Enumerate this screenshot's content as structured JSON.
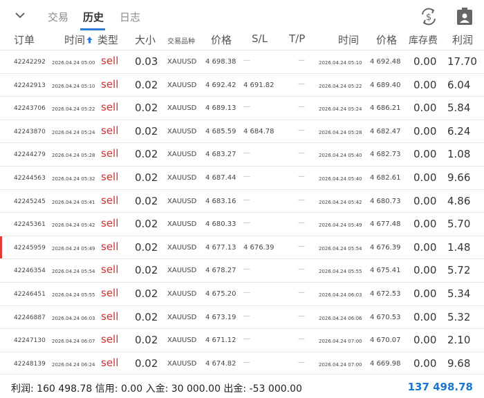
{
  "tabs": [
    {
      "label": "交易"
    },
    {
      "label": "历史"
    },
    {
      "label": "日志"
    }
  ],
  "icons": {
    "collapse": "chevron-down-icon",
    "currency": "dollar-refresh-icon",
    "report": "clipboard-person-icon"
  },
  "columns": {
    "order": "订单",
    "time": "时间",
    "type": "类型",
    "volume": "大小",
    "symbol": "交易品种",
    "price": "价格",
    "sl": "S/L",
    "tp": "T/P",
    "close_time": "时间",
    "close_price": "价格",
    "swap": "库存费",
    "profit": "利润"
  },
  "rows": [
    {
      "order": "42242292",
      "time": "2026.04.24 05:00",
      "type": "sell",
      "volume": "0.03",
      "symbol": "XAUUSD",
      "price": "4 698.38",
      "sl": "—",
      "tp": "—",
      "close_time": "2026.04.24 05:10",
      "close_price": "4 692.48",
      "swap": "0.00",
      "profit": "17.70"
    },
    {
      "order": "42242913",
      "time": "2026.04.24 05:10",
      "type": "sell",
      "volume": "0.02",
      "symbol": "XAUUSD",
      "price": "4 692.42",
      "sl": "4 691.82",
      "tp": "—",
      "close_time": "2026.04.24 05:22",
      "close_price": "4 689.40",
      "swap": "0.00",
      "profit": "6.04"
    },
    {
      "order": "42243706",
      "time": "2026.04.24 05:22",
      "type": "sell",
      "volume": "0.02",
      "symbol": "XAUUSD",
      "price": "4 689.13",
      "sl": "—",
      "tp": "—",
      "close_time": "2026.04.24 05:24",
      "close_price": "4 686.21",
      "swap": "0.00",
      "profit": "5.84"
    },
    {
      "order": "42243870",
      "time": "2026.04.24 05:24",
      "type": "sell",
      "volume": "0.02",
      "symbol": "XAUUSD",
      "price": "4 685.59",
      "sl": "4 684.78",
      "tp": "—",
      "close_time": "2026.04.24 05:28",
      "close_price": "4 682.47",
      "swap": "0.00",
      "profit": "6.24"
    },
    {
      "order": "42244279",
      "time": "2026.04.24 05:28",
      "type": "sell",
      "volume": "0.02",
      "symbol": "XAUUSD",
      "price": "4 683.27",
      "sl": "—",
      "tp": "—",
      "close_time": "2026.04.24 05:40",
      "close_price": "4 682.73",
      "swap": "0.00",
      "profit": "1.08"
    },
    {
      "order": "42244563",
      "time": "2026.04.24 05:32",
      "type": "sell",
      "volume": "0.02",
      "symbol": "XAUUSD",
      "price": "4 687.44",
      "sl": "—",
      "tp": "—",
      "close_time": "2026.04.24 05:40",
      "close_price": "4 682.61",
      "swap": "0.00",
      "profit": "9.66"
    },
    {
      "order": "42245245",
      "time": "2026.04.24 05:41",
      "type": "sell",
      "volume": "0.02",
      "symbol": "XAUUSD",
      "price": "4 683.16",
      "sl": "—",
      "tp": "—",
      "close_time": "2026.04.24 05:42",
      "close_price": "4 680.73",
      "swap": "0.00",
      "profit": "4.86"
    },
    {
      "order": "42245361",
      "time": "2026.04.24 05:42",
      "type": "sell",
      "volume": "0.02",
      "symbol": "XAUUSD",
      "price": "4 680.33",
      "sl": "—",
      "tp": "—",
      "close_time": "2026.04.24 05:49",
      "close_price": "4 677.48",
      "swap": "0.00",
      "profit": "5.70"
    },
    {
      "order": "42245959",
      "time": "2026.04.24 05:49",
      "type": "sell",
      "volume": "0.02",
      "symbol": "XAUUSD",
      "price": "4 677.13",
      "sl": "4 676.39",
      "tp": "—",
      "close_time": "2026.04.24 05:54",
      "close_price": "4 676.39",
      "swap": "0.00",
      "profit": "1.48",
      "marked": true
    },
    {
      "order": "42246354",
      "time": "2026.04.24 05:54",
      "type": "sell",
      "volume": "0.02",
      "symbol": "XAUUSD",
      "price": "4 678.27",
      "sl": "—",
      "tp": "—",
      "close_time": "2026.04.24 05:55",
      "close_price": "4 675.41",
      "swap": "0.00",
      "profit": "5.72"
    },
    {
      "order": "42246451",
      "time": "2026.04.24 05:55",
      "type": "sell",
      "volume": "0.02",
      "symbol": "XAUUSD",
      "price": "4 675.20",
      "sl": "—",
      "tp": "—",
      "close_time": "2026.04.24 06:03",
      "close_price": "4 672.53",
      "swap": "0.00",
      "profit": "5.34"
    },
    {
      "order": "42246887",
      "time": "2026.04.24 06:03",
      "type": "sell",
      "volume": "0.02",
      "symbol": "XAUUSD",
      "price": "4 673.19",
      "sl": "—",
      "tp": "—",
      "close_time": "2026.04.24 06:06",
      "close_price": "4 670.53",
      "swap": "0.00",
      "profit": "5.32"
    },
    {
      "order": "42247130",
      "time": "2026.04.24 06:07",
      "type": "sell",
      "volume": "0.02",
      "symbol": "XAUUSD",
      "price": "4 671.12",
      "sl": "—",
      "tp": "—",
      "close_time": "2026.04.24 07:00",
      "close_price": "4 670.07",
      "swap": "0.00",
      "profit": "2.10"
    },
    {
      "order": "42248139",
      "time": "2026.04.24 06:24",
      "type": "sell",
      "volume": "0.02",
      "symbol": "XAUUSD",
      "price": "4 674.82",
      "sl": "—",
      "tp": "—",
      "close_time": "2026.04.24 07:00",
      "close_price": "4 669.98",
      "swap": "0.00",
      "profit": "9.68"
    }
  ],
  "footer": {
    "summary": "利润: 160 498.78  信用: 0.00  入金: 30 000.00  出金: -53 000.00",
    "total": "137 498.78"
  },
  "colors": {
    "accent": "#2b7bd8",
    "sell": "#d32f2f",
    "total": "#1976d2",
    "marker": "#e53935"
  }
}
